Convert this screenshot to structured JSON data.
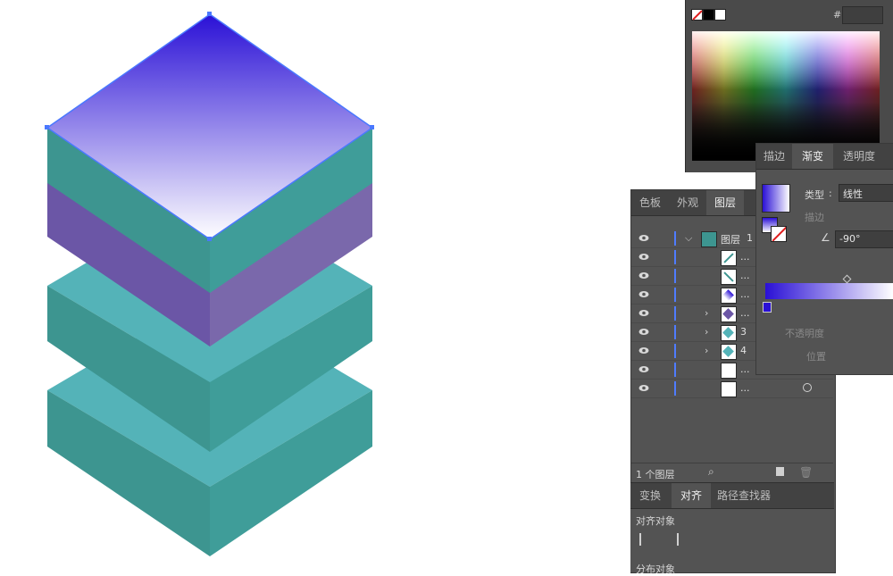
{
  "colors": {
    "panel_bg": "#535353",
    "panel_dark": "#424242",
    "accent_blue": "#4f7cff",
    "teal_light": "#54b3b8",
    "teal_dark": "#3d9590",
    "purple_left": "#6b56a6",
    "purple_right": "#7a68ab",
    "gradient_start": "#2a10d6",
    "gradient_end": "#ffffff"
  },
  "color_picker": {
    "hex_label": "#"
  },
  "layers_panel": {
    "tabs": [
      {
        "label": "色板",
        "active": false
      },
      {
        "label": "外观",
        "active": false
      },
      {
        "label": "图层",
        "active": true
      }
    ],
    "rows": [
      {
        "label": "图层",
        "suffix": "1",
        "has_expand": true
      },
      {
        "label": "...",
        "has_expand": false
      },
      {
        "label": "...",
        "has_expand": false
      },
      {
        "label": "...",
        "has_expand": false
      },
      {
        "label": "...",
        "has_expand": true
      },
      {
        "label": "3",
        "has_expand": true
      },
      {
        "label": "4",
        "has_expand": true
      },
      {
        "label": "...",
        "has_expand": false
      },
      {
        "label": "...",
        "has_expand": false
      }
    ],
    "footer_label": "1 个图层"
  },
  "gradient_panel": {
    "tabs": [
      {
        "label": "描边",
        "active": false
      },
      {
        "label": "渐变",
        "active": true
      },
      {
        "label": "透明度",
        "active": false
      }
    ],
    "type_label": "类型",
    "type_value": "线性",
    "stroke_label": "描边",
    "angle_value": "-90°",
    "opacity_label": "不透明度",
    "position_label": "位置"
  },
  "align_panel": {
    "tabs": [
      {
        "label": "变换",
        "active": false
      },
      {
        "label": "对齐",
        "active": true
      },
      {
        "label": "路径查找器",
        "active": false
      }
    ],
    "align_objects_label": "对齐对象",
    "distribute_objects_label": "分布对象"
  }
}
